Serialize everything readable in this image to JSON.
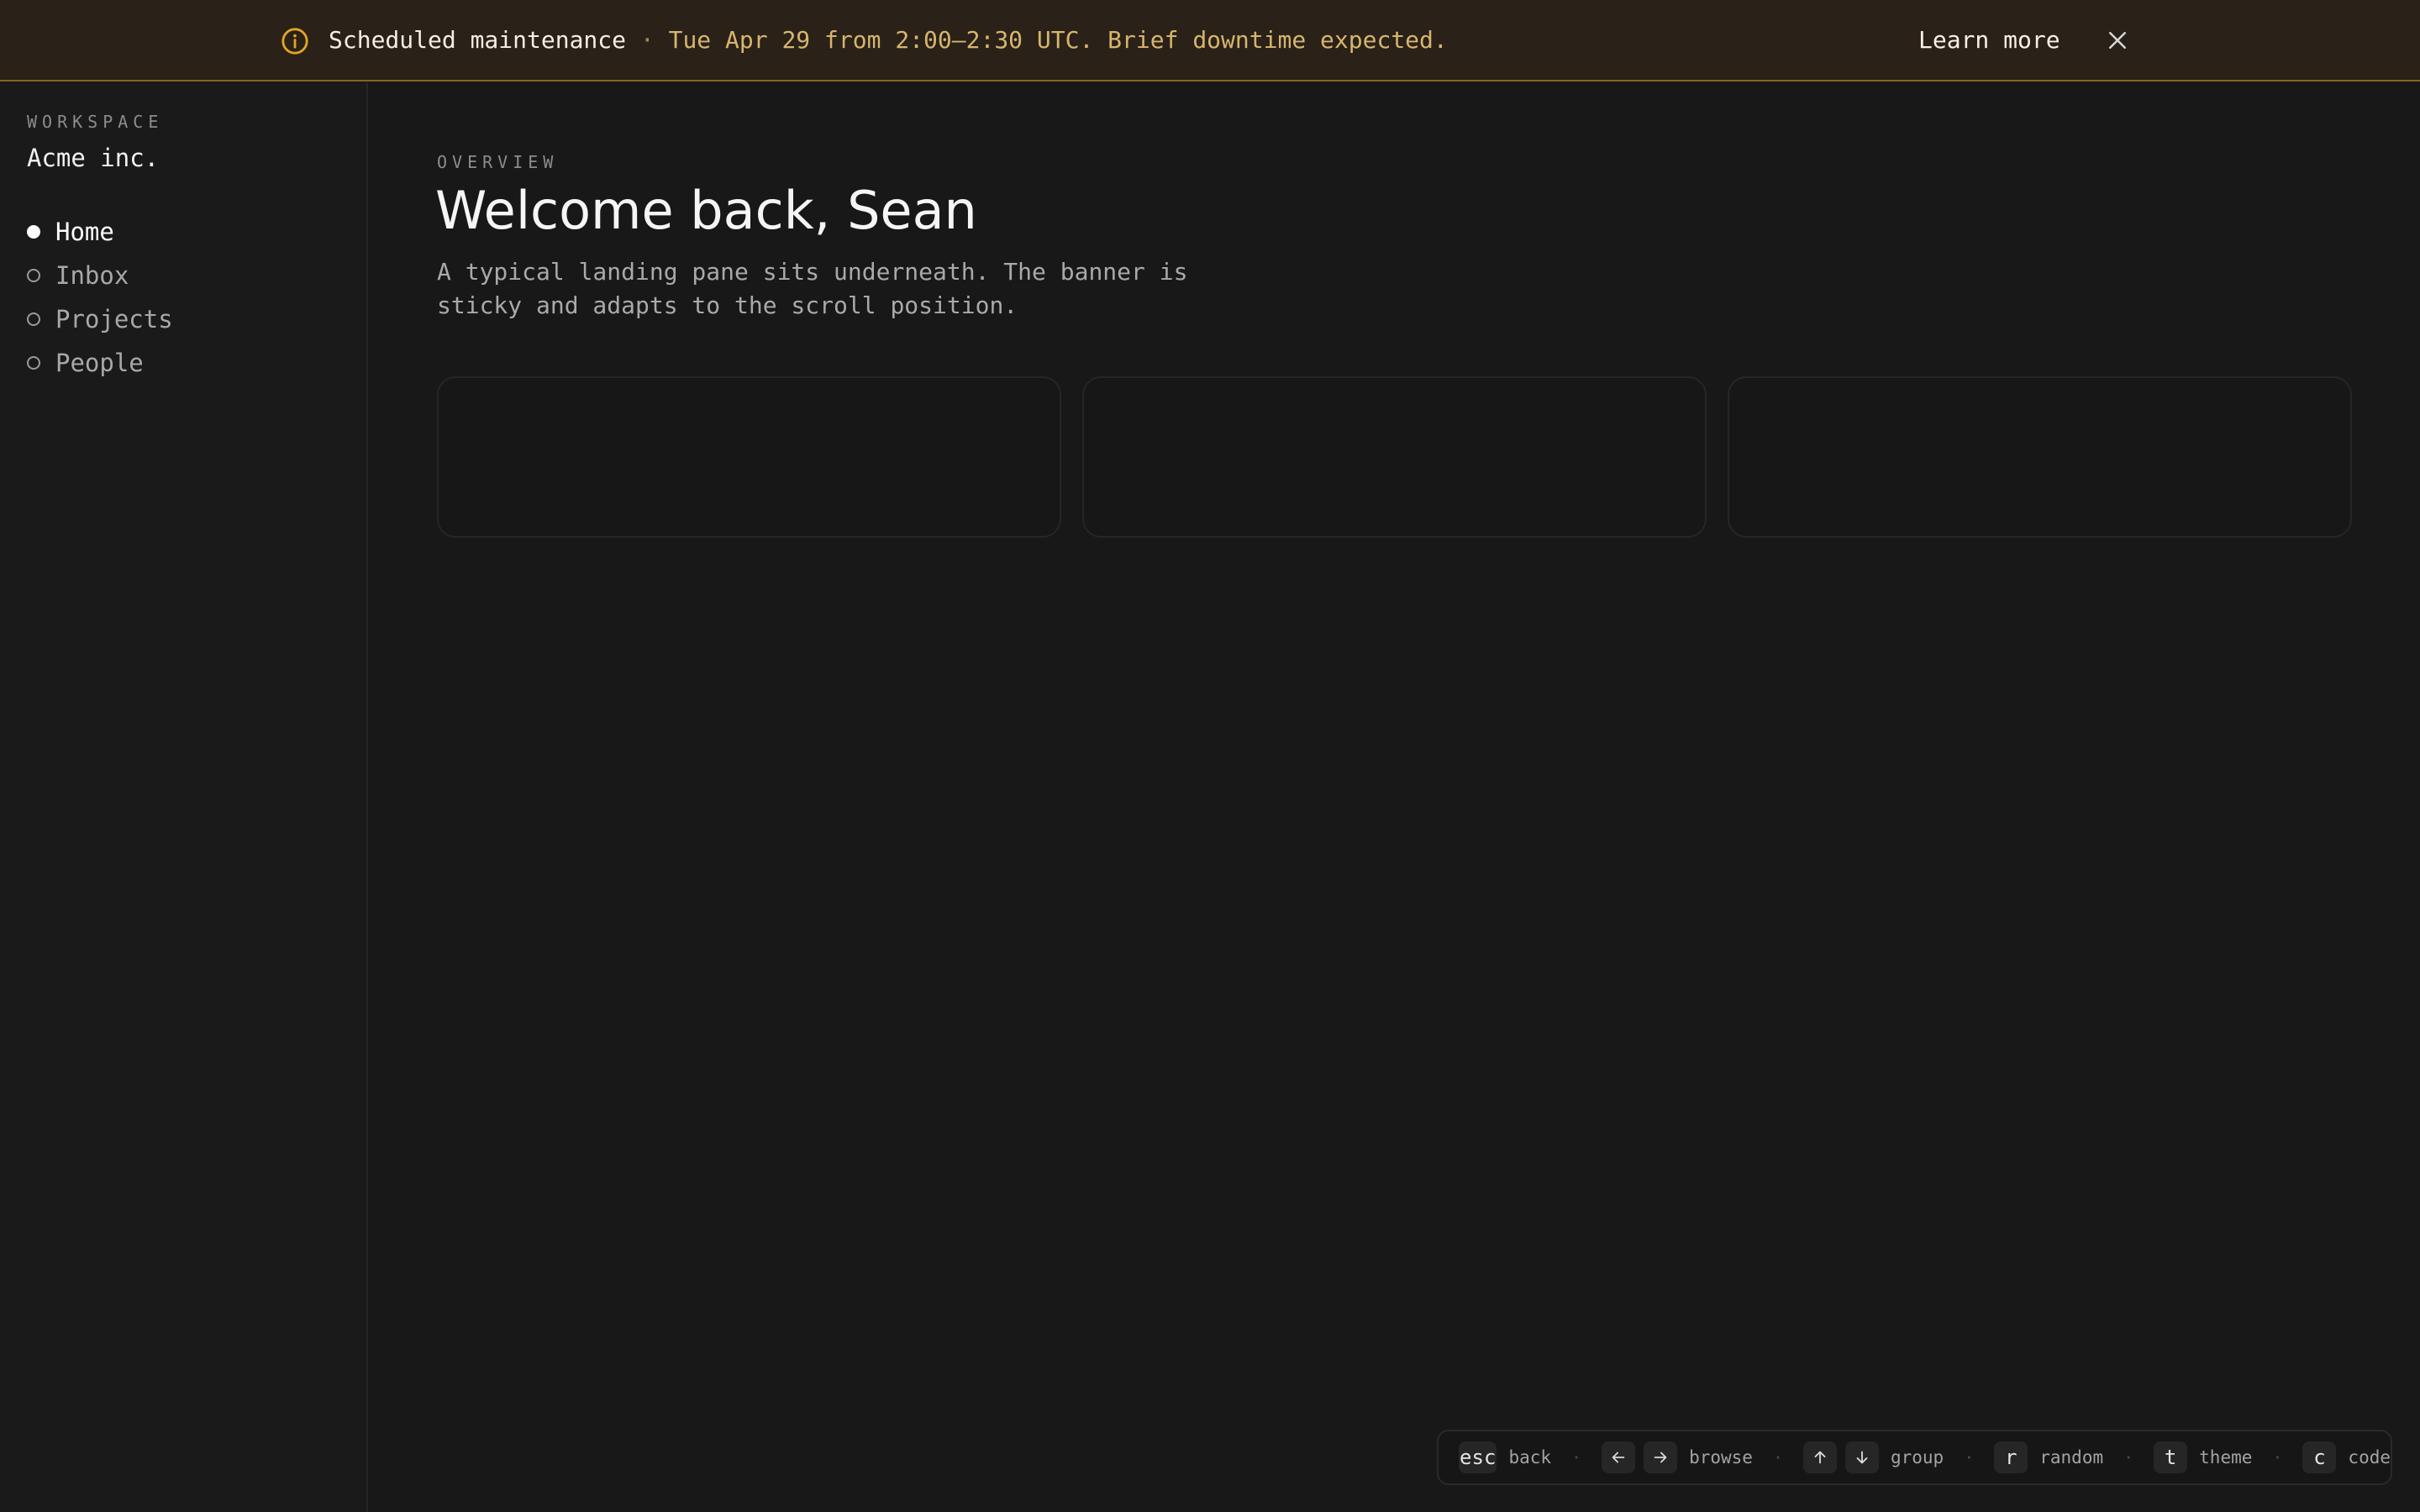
{
  "banner": {
    "title": "Scheduled maintenance",
    "separator": "·",
    "detail": "Tue Apr 29 from 2:00–2:30 UTC. Brief downtime expected.",
    "learn_more": "Learn more",
    "icon": "info-icon",
    "close_icon": "close-icon",
    "accent_color": "#e0a526"
  },
  "sidebar": {
    "workspace_label": "WORKSPACE",
    "workspace_name": "Acme inc.",
    "items": [
      {
        "label": "Home",
        "active": true
      },
      {
        "label": "Inbox",
        "active": false
      },
      {
        "label": "Projects",
        "active": false
      },
      {
        "label": "People",
        "active": false
      }
    ]
  },
  "main": {
    "overline": "OVERVIEW",
    "title": "Welcome back, Sean",
    "description": "A typical landing pane sits underneath. The banner is sticky and adapts to the scroll position."
  },
  "shortcuts": [
    {
      "keys": [
        "esc"
      ],
      "label": "back"
    },
    {
      "keys": [
        "arrow-left-icon",
        "arrow-right-icon"
      ],
      "label": "browse"
    },
    {
      "keys": [
        "arrow-up-icon",
        "arrow-down-icon"
      ],
      "label": "group"
    },
    {
      "keys": [
        "r"
      ],
      "label": "random"
    },
    {
      "keys": [
        "t"
      ],
      "label": "theme"
    },
    {
      "keys": [
        "c"
      ],
      "label": "code"
    }
  ],
  "shortcut_separator": "·"
}
